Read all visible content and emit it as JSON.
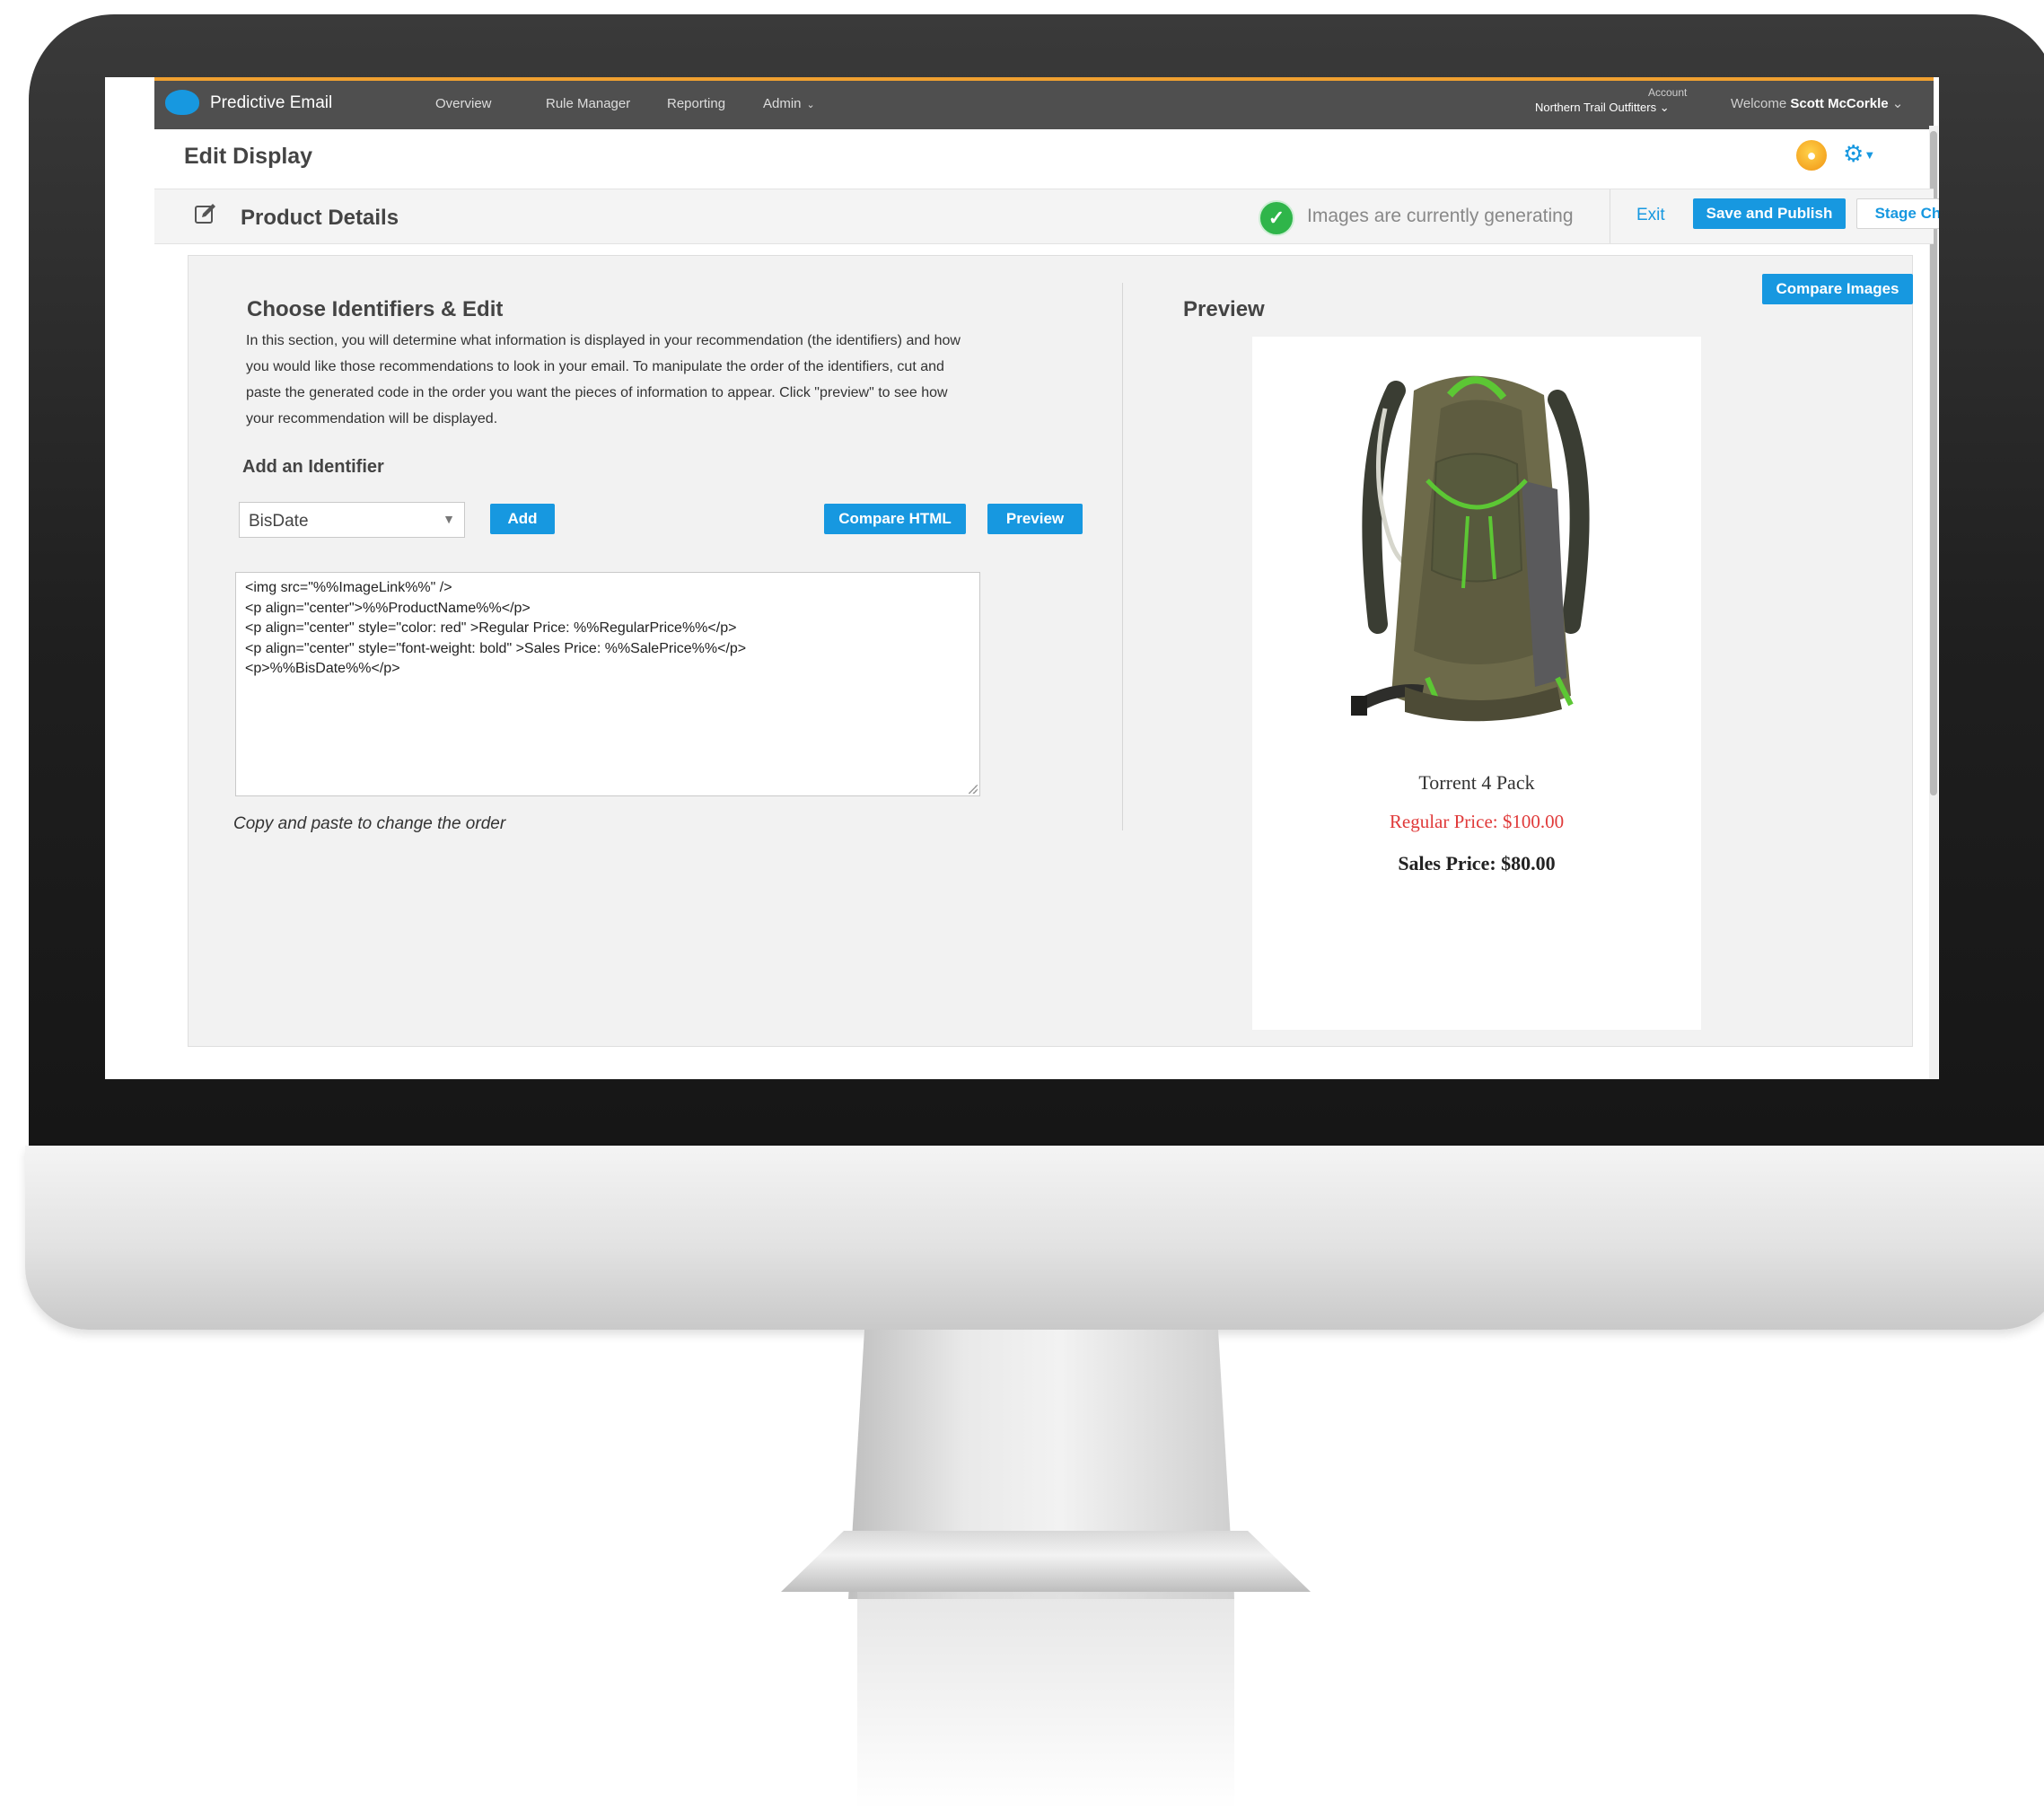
{
  "app": {
    "name": "Predictive Email"
  },
  "nav": {
    "items": [
      "Overview",
      "Rule Manager",
      "Reporting",
      "Admin"
    ]
  },
  "account": {
    "label": "Account",
    "name": "Northern Trail Outfitters"
  },
  "user": {
    "welcome": "Welcome",
    "name": "Scott McCorkle"
  },
  "page": {
    "title": "Edit Display"
  },
  "toolbar": {
    "section_title": "Product Details",
    "status": "Images are currently generating",
    "exit_label": "Exit",
    "save_label": "Save and Publish",
    "stage_label": "Stage Changes"
  },
  "editor": {
    "heading": "Choose Identifiers & Edit",
    "intro": "In this section, you will determine what information is displayed in your recommendation (the identifiers) and how you would like those recommendations to look in your email. To manipulate the order of the identifiers, cut and paste the generated code in the order you want the pieces of information to appear. Click \"preview\" to see how your recommendation will be displayed.",
    "add_heading": "Add an Identifier",
    "selected_identifier": "BisDate",
    "add_label": "Add",
    "compare_html_label": "Compare HTML",
    "preview_label": "Preview",
    "code": "<img src=\"%%ImageLink%%\" />\n<p align=\"center\">%%ProductName%%</p>\n<p align=\"center\" style=\"color: red\" >Regular Price: %%RegularPrice%%</p>\n<p align=\"center\" style=\"font-weight: bold\" >Sales Price: %%SalePrice%%</p>\n<p>%%BisDate%%</p>",
    "hint": "Copy and paste to change the order"
  },
  "preview": {
    "heading": "Preview",
    "compare_images_label": "Compare Images",
    "product_name": "Torrent 4 Pack",
    "regular_price": "Regular Price: $100.00",
    "sale_price": "Sales Price: $80.00"
  },
  "icons": {
    "brand": "cloud-logo-icon",
    "status": "check-circle-icon",
    "help": "lightbulb-icon",
    "settings": "gear-icon",
    "edit": "edit-pencil-icon"
  },
  "colors": {
    "accent": "#1798e0",
    "nav_bg": "#4f4f4f",
    "nav_top_border": "#f0a030",
    "success": "#2fb54a",
    "regular_price": "#e03a3a"
  }
}
